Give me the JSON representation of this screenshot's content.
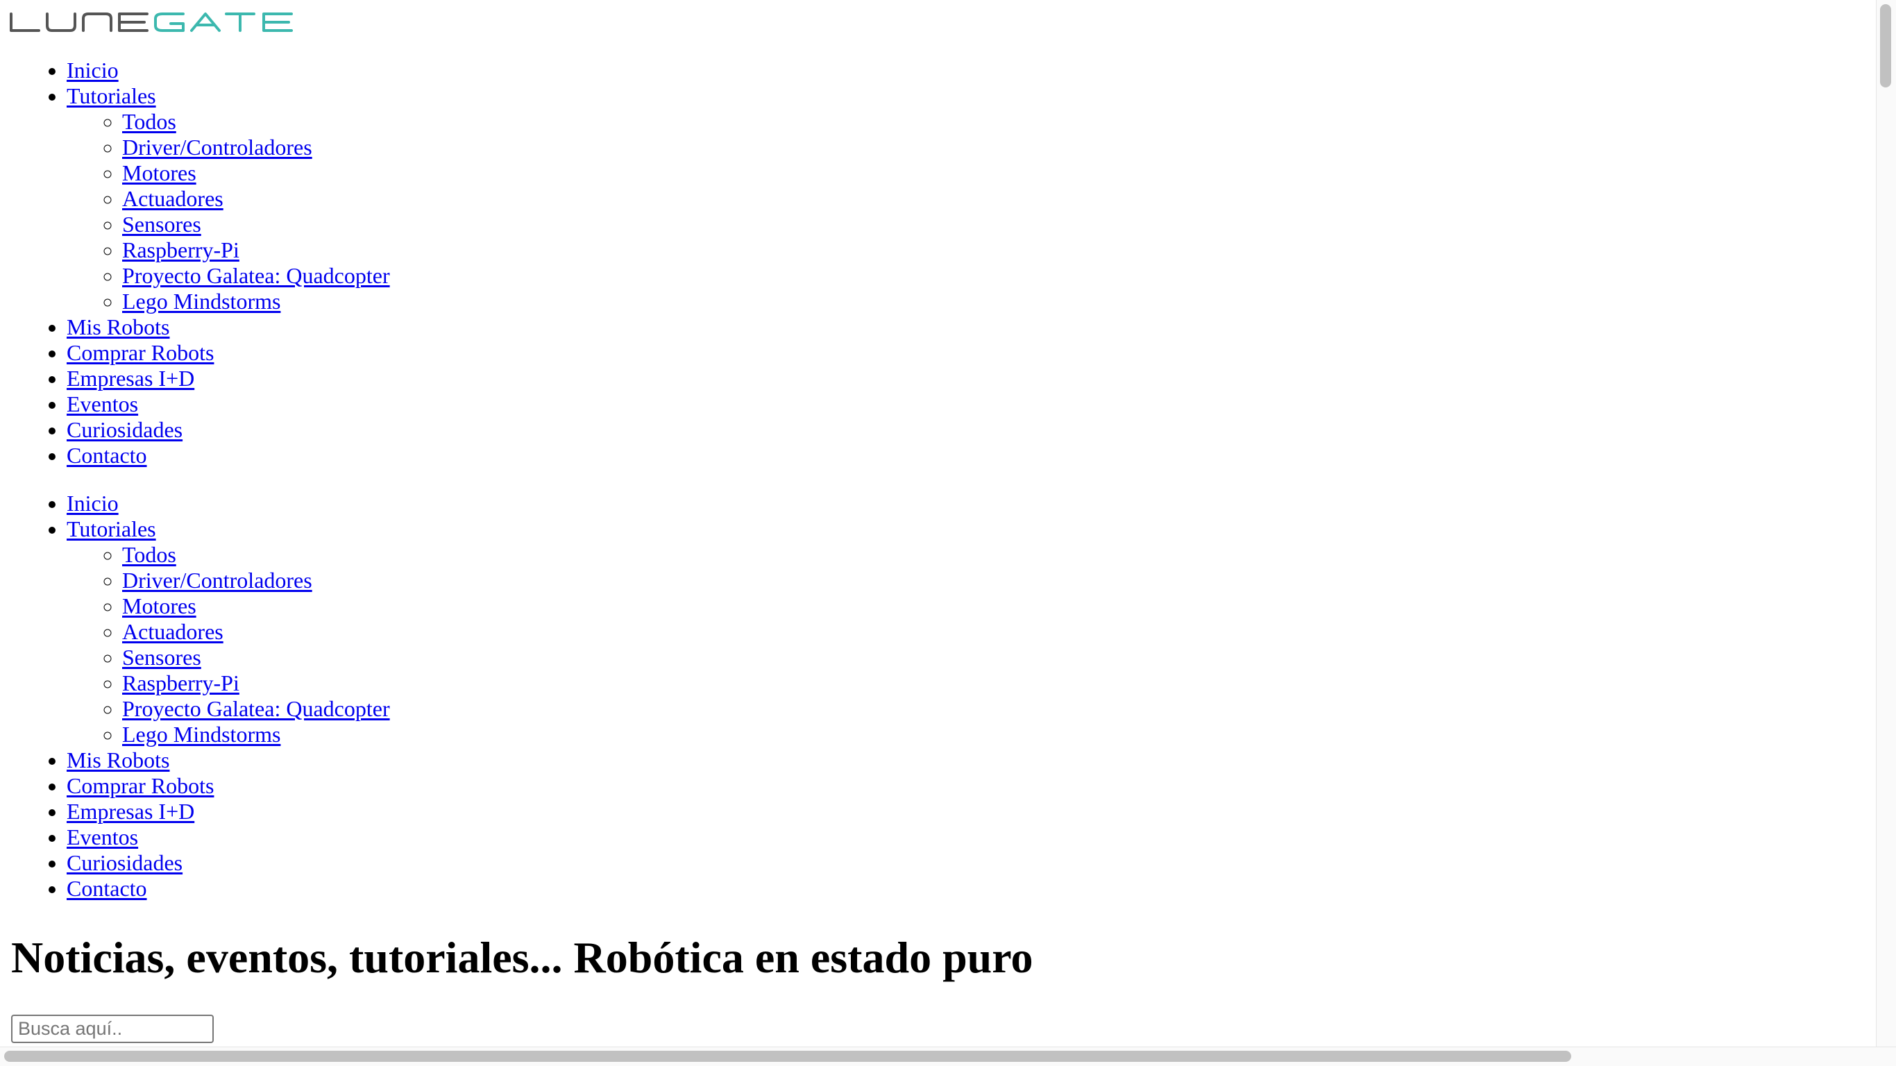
{
  "logo": {
    "text": "LUNEGATE",
    "colors": {
      "lune": "#555555",
      "gate": "#3cb8ae"
    }
  },
  "nav_primary": {
    "items": [
      {
        "label": "Inicio"
      },
      {
        "label": "Tutoriales",
        "children": [
          {
            "label": "Todos"
          },
          {
            "label": "Driver/Controladores"
          },
          {
            "label": "Motores"
          },
          {
            "label": "Actuadores"
          },
          {
            "label": "Sensores"
          },
          {
            "label": "Raspberry-Pi"
          },
          {
            "label": "Proyecto Galatea: Quadcopter"
          },
          {
            "label": "Lego Mindstorms"
          }
        ]
      },
      {
        "label": "Mis Robots"
      },
      {
        "label": "Comprar Robots"
      },
      {
        "label": "Empresas I+D"
      },
      {
        "label": "Eventos"
      },
      {
        "label": "Curiosidades"
      },
      {
        "label": "Contacto"
      }
    ]
  },
  "nav_secondary": {
    "items": [
      {
        "label": "Inicio"
      },
      {
        "label": "Tutoriales",
        "children": [
          {
            "label": "Todos"
          },
          {
            "label": "Driver/Controladores"
          },
          {
            "label": "Motores"
          },
          {
            "label": "Actuadores"
          },
          {
            "label": "Sensores"
          },
          {
            "label": "Raspberry-Pi"
          },
          {
            "label": "Proyecto Galatea: Quadcopter"
          },
          {
            "label": "Lego Mindstorms"
          }
        ]
      },
      {
        "label": "Mis Robots"
      },
      {
        "label": "Comprar Robots"
      },
      {
        "label": "Empresas I+D"
      },
      {
        "label": "Eventos"
      },
      {
        "label": "Curiosidades"
      },
      {
        "label": "Contacto"
      }
    ]
  },
  "tagline": "Noticias, eventos, tutoriales... Robótica en estado puro",
  "search": {
    "placeholder": "Busca aquí..",
    "value": ""
  },
  "colors": {
    "link": "#0000ee",
    "text": "#000000",
    "background": "#ffffff"
  }
}
